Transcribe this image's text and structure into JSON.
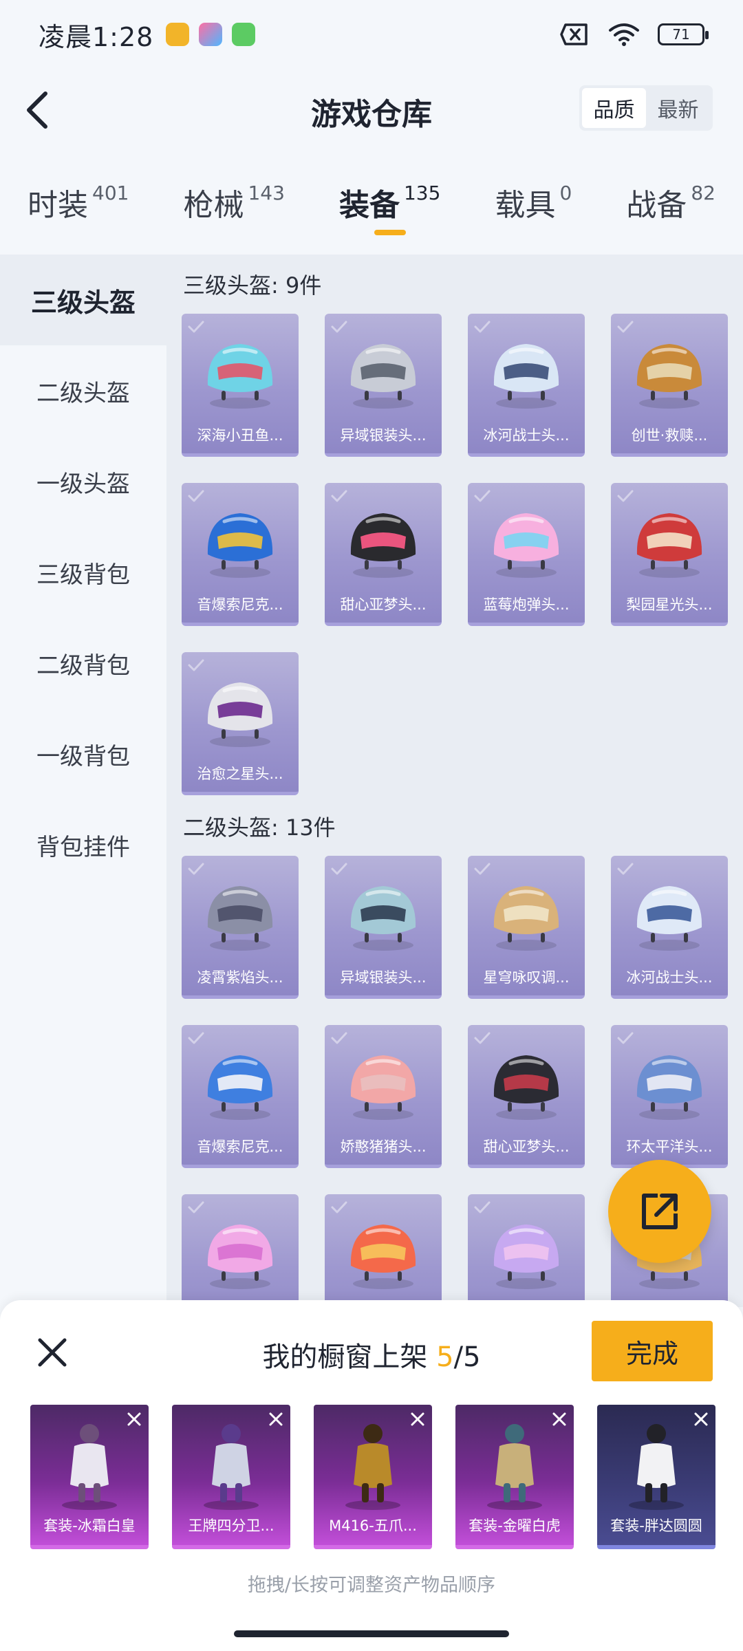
{
  "status_bar": {
    "time": "凌晨1:28",
    "battery": "71"
  },
  "header": {
    "title": "游戏仓库",
    "sort_options": [
      "品质",
      "最新"
    ],
    "sort_active": "品质"
  },
  "tabs": [
    {
      "label": "时装",
      "count": "401"
    },
    {
      "label": "枪械",
      "count": "143"
    },
    {
      "label": "装备",
      "count": "135",
      "active": true
    },
    {
      "label": "载具",
      "count": "0"
    },
    {
      "label": "战备",
      "count": "82"
    }
  ],
  "sidebar": [
    {
      "label": "三级头盔",
      "active": true
    },
    {
      "label": "二级头盔"
    },
    {
      "label": "一级头盔"
    },
    {
      "label": "三级背包"
    },
    {
      "label": "二级背包"
    },
    {
      "label": "一级背包"
    },
    {
      "label": "背包挂件"
    }
  ],
  "sections": [
    {
      "title": "三级头盔: 9件",
      "items": [
        "深海小丑鱼...",
        "异域银装头...",
        "冰河战士头...",
        "创世·救赎...",
        "音爆索尼克...",
        "甜心亚梦头...",
        "蓝莓炮弹头...",
        "梨园星光头...",
        "治愈之星头..."
      ]
    },
    {
      "title": "二级头盔: 13件",
      "items": [
        "凌霄紫焰头...",
        "异域银装头...",
        "星穹咏叹调...",
        "冰河战士头...",
        "音爆索尼克...",
        "娇憨猪猪头...",
        "甜心亚梦头...",
        "环太平洋头...",
        "",
        "",
        "",
        ""
      ]
    }
  ],
  "colors": {
    "accent": "#f6ae1b",
    "card_purple": "#9d97cf",
    "showcase_purple": "#7b2d96"
  },
  "sheet": {
    "title_prefix": "我的橱窗上架 ",
    "count": "5",
    "total": "/5",
    "done_label": "完成",
    "items": [
      "套装-冰霜白皇",
      "王牌四分卫...",
      "M416-五爪...",
      "套装-金曜白虎",
      "套装-胖达圆圆"
    ],
    "hint": "拖拽/长按可调整资产物品顺序"
  },
  "icons": {
    "back": "chevron-left-icon",
    "share": "share-external-icon",
    "close": "close-icon",
    "remove": "remove-x-icon"
  }
}
